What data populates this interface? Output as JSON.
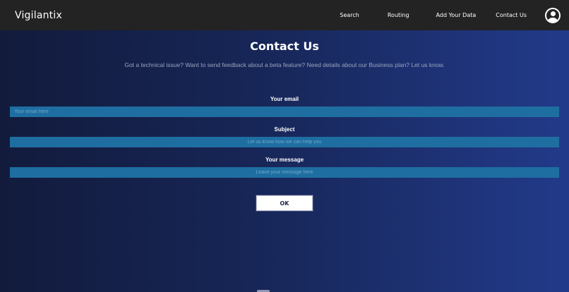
{
  "navbar": {
    "brand": "Vigilantix",
    "links": {
      "search": "Search",
      "routing": "Routing",
      "add_data": "Add Your Data",
      "contact": "Contact Us"
    },
    "avatar_icon": "user-circle-icon"
  },
  "page": {
    "title": "Contact Us",
    "subtitle": "Got a technical issue? Want to send feedback about a beta feature? Need details about our Business plan? Let us know."
  },
  "form": {
    "email": {
      "label": "Your email",
      "placeholder": "Your email here",
      "value": ""
    },
    "subject": {
      "label": "Subject",
      "placeholder": "Let us know how we can help you",
      "value": ""
    },
    "message": {
      "label": "Your message",
      "placeholder": "Leave your message here",
      "value": ""
    },
    "submit_label": "OK"
  },
  "colors": {
    "navbar_bg": "#232323",
    "input_bg": "#1f6ea1",
    "page_bg_start": "#121b3c",
    "page_bg_end": "#223a8a"
  }
}
